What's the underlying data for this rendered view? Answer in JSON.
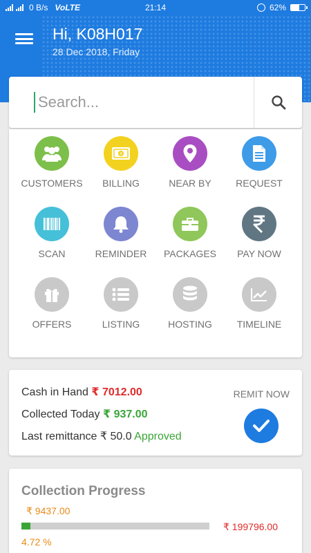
{
  "status_bar": {
    "network_speed": "0 B/s",
    "volte": "VoLTE",
    "time": "21:14",
    "battery": "62%"
  },
  "header": {
    "greeting": "Hi, K08H017",
    "date": "28 Dec 2018, Friday",
    "color": "#1e7be0"
  },
  "search": {
    "placeholder": "Search..."
  },
  "grid": [
    {
      "label": "CUSTOMERS",
      "icon": "customers-icon",
      "color": "#7cbf4a"
    },
    {
      "label": "BILLING",
      "icon": "billing-icon",
      "color": "#f2d21e"
    },
    {
      "label": "NEAR BY",
      "icon": "location-pin-icon",
      "color": "#a94ec2"
    },
    {
      "label": "REQUEST",
      "icon": "document-icon",
      "color": "#3e9be8"
    },
    {
      "label": "SCAN",
      "icon": "barcode-icon",
      "color": "#46c0d8"
    },
    {
      "label": "REMINDER",
      "icon": "bell-icon",
      "color": "#7d86d1"
    },
    {
      "label": "PACKAGES",
      "icon": "briefcase-icon",
      "color": "#8fc75a"
    },
    {
      "label": "PAY NOW",
      "icon": "rupee-icon",
      "color": "#607783"
    },
    {
      "label": "OFFERS",
      "icon": "gift-icon",
      "color": "#c9c9c9"
    },
    {
      "label": "LISTING",
      "icon": "list-icon",
      "color": "#c9c9c9"
    },
    {
      "label": "HOSTING",
      "icon": "database-icon",
      "color": "#c9c9c9"
    },
    {
      "label": "TIMELINE",
      "icon": "trend-chart-icon",
      "color": "#c9c9c9"
    }
  ],
  "cash": {
    "cash_in_hand_label": "Cash in Hand",
    "cash_in_hand_value": "₹ 7012.00",
    "collected_today_label": "Collected Today",
    "collected_today_value": "₹ 937.00",
    "last_remittance_label": "Last remittance",
    "last_remittance_value": "₹ 50.0",
    "last_remittance_status": "Approved",
    "remit_label": "REMIT NOW"
  },
  "progress": {
    "title": "Collection Progress",
    "collected": "₹ 9437.00",
    "target": "₹ 199796.00",
    "percent_label": "4.72 %",
    "percent": 4.72
  }
}
